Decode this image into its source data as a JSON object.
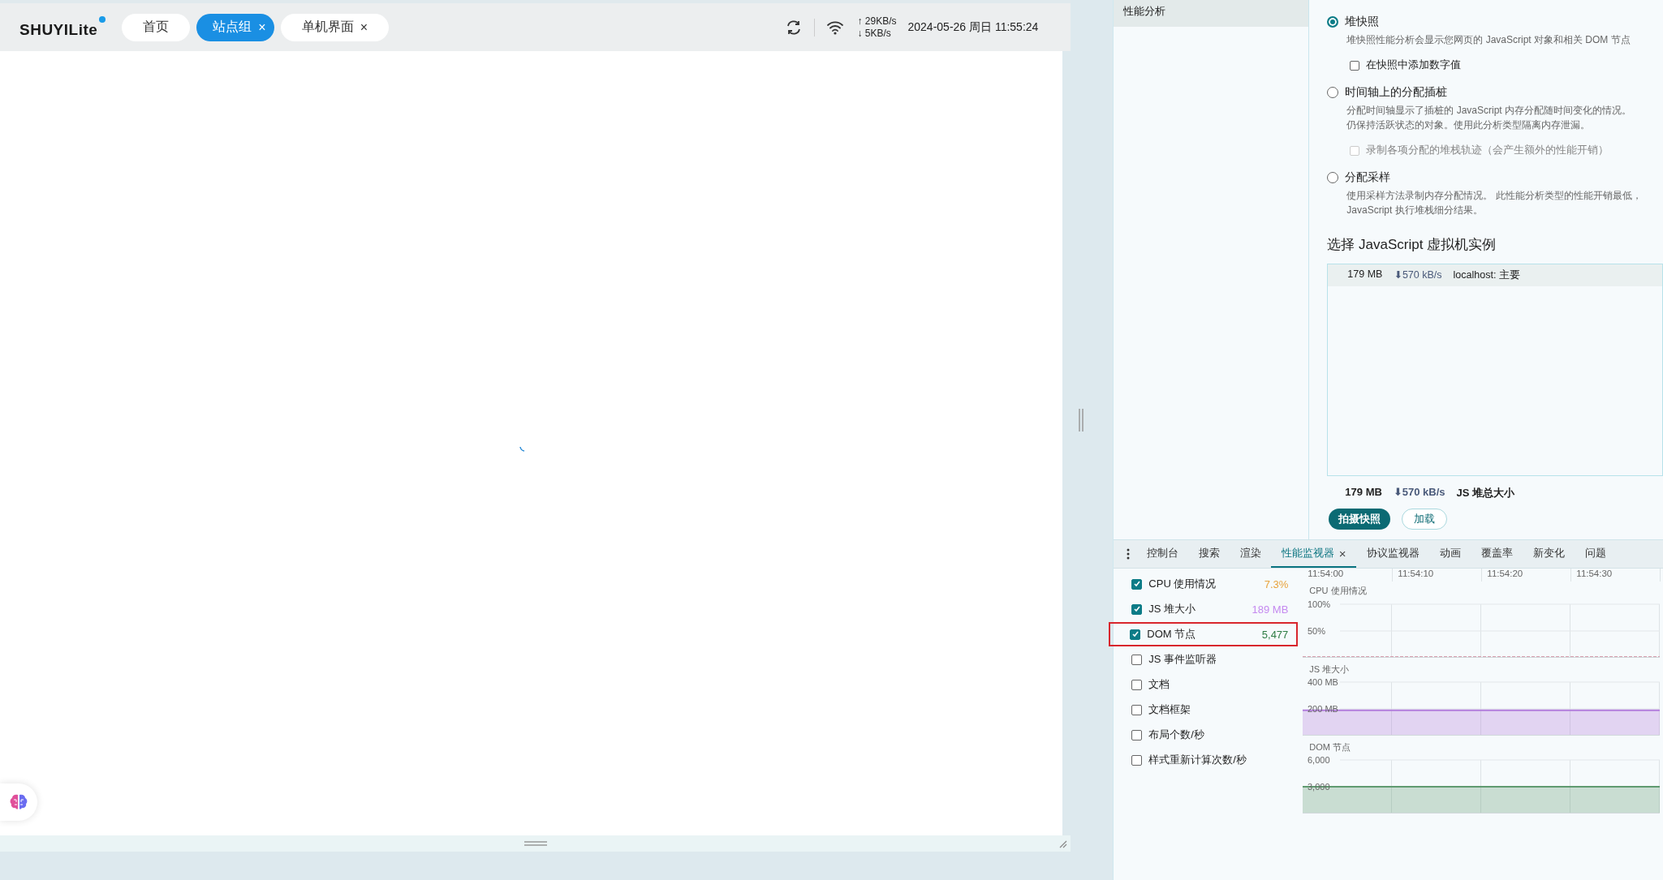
{
  "app": {
    "logo": "SHUYILite",
    "close_glyph": "×",
    "tabs": [
      {
        "label": "首页",
        "selected": false,
        "closable": false
      },
      {
        "label": "站点组",
        "selected": true,
        "closable": true
      },
      {
        "label": "单机界面",
        "selected": false,
        "closable": true
      }
    ],
    "upload": "↑ 29KB/s",
    "download": "↓ 5KB/s",
    "datetime": "2024-05-26 周日 11:55:24"
  },
  "devtools": {
    "sidebar": {
      "items": [
        {
          "label": "性能分析",
          "selected": true
        }
      ]
    },
    "profile_types": [
      {
        "label": "堆快照",
        "selected": true,
        "description_lines": [
          "堆快照性能分析会显示您网页的 JavaScript 对象和相关 DOM 节点"
        ],
        "option": {
          "label": "在快照中添加数字值",
          "checked": false,
          "disabled": false
        }
      },
      {
        "label": "时间轴上的分配插桩",
        "selected": false,
        "description_lines": [
          "分配时间轴显示了插桩的 JavaScript 内存分配随时间变化的情况。",
          "仍保持活跃状态的对象。使用此分析类型隔离内存泄漏。"
        ],
        "option": {
          "label": "录制各项分配的堆栈轨迹（会产生额外的性能开销）",
          "checked": false,
          "disabled": true
        }
      },
      {
        "label": "分配采样",
        "selected": false,
        "description_lines": [
          "使用采样方法录制内存分配情况。 此性能分析类型的性能开销最低，",
          "JavaScript 执行堆栈细分结果。"
        ]
      }
    ],
    "vm_section": {
      "title": "选择 JavaScript 虚拟机实例",
      "instances": [
        {
          "size": "179 MB",
          "rate": "⬇570 kB/s",
          "name": "localhost: 主要",
          "selected": true
        }
      ],
      "total": {
        "size": "179 MB",
        "rate": "⬇570 kB/s",
        "label": "JS 堆总大小"
      }
    },
    "buttons": [
      {
        "label": "拍摄快照",
        "kind": "primary"
      },
      {
        "label": "加载",
        "kind": "secondary"
      }
    ],
    "drawer_tabs": [
      {
        "label": "控制台",
        "selected": false,
        "closable": false
      },
      {
        "label": "搜索",
        "selected": false,
        "closable": false
      },
      {
        "label": "渲染",
        "selected": false,
        "closable": false
      },
      {
        "label": "性能监视器",
        "selected": true,
        "closable": true
      },
      {
        "label": "协议监视器",
        "selected": false,
        "closable": false
      },
      {
        "label": "动画",
        "selected": false,
        "closable": false
      },
      {
        "label": "覆盖率",
        "selected": false,
        "closable": false
      },
      {
        "label": "新变化",
        "selected": false,
        "closable": false
      },
      {
        "label": "问题",
        "selected": false,
        "closable": false
      }
    ],
    "monitor": {
      "metrics": [
        {
          "label": "CPU 使用情况",
          "checked": true,
          "value": "7.3%",
          "color": "#e8a33d",
          "highlighted": false
        },
        {
          "label": "JS 堆大小",
          "checked": true,
          "value": "189 MB",
          "color": "#c58af0",
          "highlighted": false
        },
        {
          "label": "DOM 节点",
          "checked": true,
          "value": "5,477",
          "color": "#2f7d45",
          "highlighted": true
        },
        {
          "label": "JS 事件监听器",
          "checked": false,
          "highlighted": false
        },
        {
          "label": "文档",
          "checked": false,
          "highlighted": false
        },
        {
          "label": "文档框架",
          "checked": false,
          "highlighted": false
        },
        {
          "label": "布局个数/秒",
          "checked": false,
          "highlighted": false
        },
        {
          "label": "样式重新计算次数/秒",
          "checked": false,
          "highlighted": false
        }
      ],
      "charts": [
        {
          "chart_data": {
            "type": "line",
            "grid": true,
            "categories": [
              "11:54:00",
              "11:54:10",
              "11:54:20",
              "11:54:30",
              null
            ],
            "series": [
              {
                "name": "CPU 使用情况",
                "color": "#d9a0b0",
                "line_style": "dashed",
                "values": [
                  2,
                  2,
                  2,
                  2,
                  2
                ]
              }
            ],
            "ylim": [
              0,
              100
            ],
            "yticks": [
              {
                "value": 50,
                "label": "50%"
              },
              {
                "value": 100,
                "label": "100%"
              }
            ]
          }
        },
        {
          "chart_data": {
            "type": "area",
            "grid": true,
            "series": [
              {
                "name": "JS 堆大小",
                "color": "#b27ddc",
                "values": [
                  190,
                  190,
                  190,
                  190,
                  190
                ]
              }
            ],
            "ylim": [
              0,
              400
            ],
            "yticks": [
              {
                "value": 200,
                "label": "200 MB"
              },
              {
                "value": 400,
                "label": "400 MB"
              }
            ]
          }
        },
        {
          "chart_data": {
            "type": "area",
            "grid": true,
            "series": [
              {
                "name": "DOM 节点",
                "color": "#5f9a70",
                "values": [
                  3000,
                  3000,
                  3000,
                  3000,
                  3000
                ]
              }
            ],
            "ylim": [
              0,
              6000
            ],
            "yticks": [
              {
                "value": 3000,
                "label": "3,000"
              },
              {
                "value": 6000,
                "label": "6,000"
              }
            ]
          }
        }
      ]
    }
  }
}
